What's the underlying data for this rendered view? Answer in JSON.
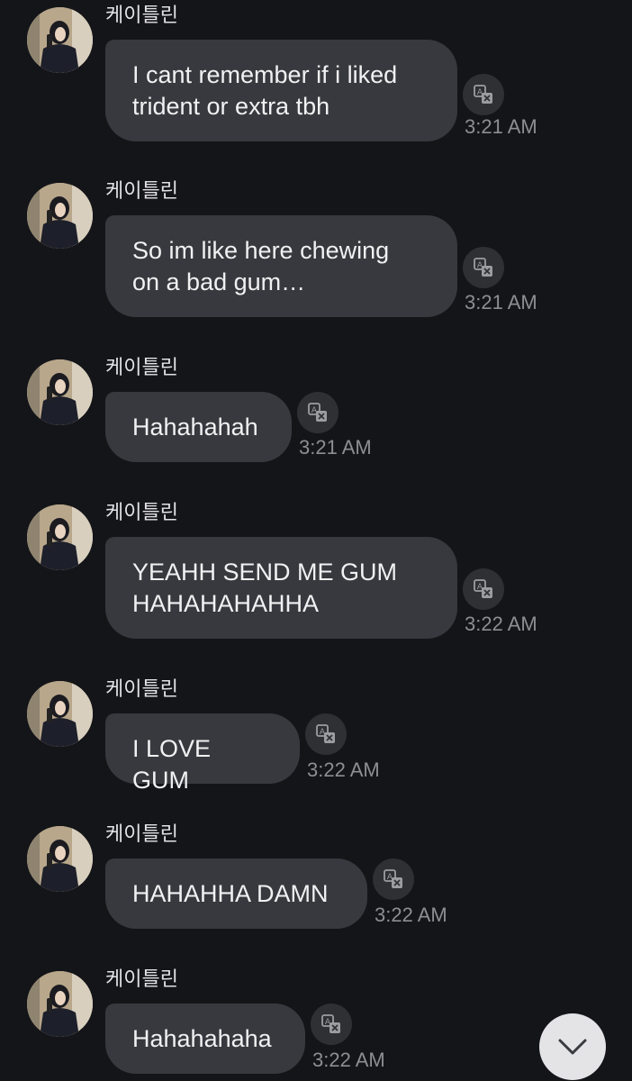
{
  "chat": {
    "messages": [
      {
        "sender": "케이틀린",
        "text": "I cant remember if i liked\ntrident or extra tbh",
        "time": "3:21 AM",
        "translate_icon": "translate-icon"
      },
      {
        "sender": "케이틀린",
        "text": "So im like here chewing\non a bad gum…",
        "time": "3:21 AM",
        "translate_icon": "translate-icon"
      },
      {
        "sender": "케이틀린",
        "text": "Hahahahah",
        "time": "3:21 AM",
        "translate_icon": "translate-icon"
      },
      {
        "sender": "케이틀린",
        "text": "YEAHH SEND ME GUM\nHAHAHAHAHHA",
        "time": "3:22 AM",
        "translate_icon": "translate-icon"
      },
      {
        "sender": "케이틀린",
        "text": "I LOVE GUM",
        "time": "3:22 AM",
        "translate_icon": "translate-icon"
      },
      {
        "sender": "케이틀린",
        "text": "HAHAHHA DAMN",
        "time": "3:22 AM",
        "translate_icon": "translate-icon"
      },
      {
        "sender": "케이틀린",
        "text": "Hahahahaha",
        "time": "3:22 AM",
        "translate_icon": "translate-icon"
      }
    ]
  },
  "controls": {
    "scroll_down_icon": "chevron-down-icon"
  },
  "colors": {
    "background": "#141519",
    "bubble": "#38393e",
    "text": "#f1f1f3",
    "timestamp": "#8d8e93",
    "scroll_button": "#e4e4e7"
  }
}
